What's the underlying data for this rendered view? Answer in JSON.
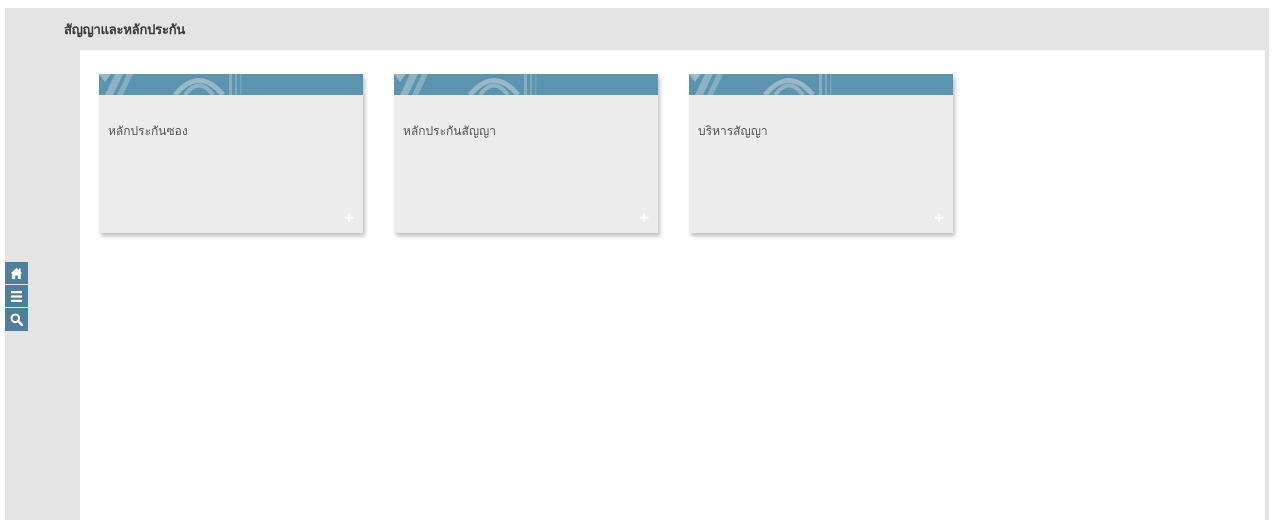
{
  "header": {
    "title": "สัญญาและหลักประกัน"
  },
  "toolbar": {
    "items": [
      {
        "icon": "home-icon"
      },
      {
        "icon": "menu-icon"
      },
      {
        "icon": "search-icon"
      }
    ]
  },
  "tiles": [
    {
      "label": "หลักประกันซอง",
      "action_symbol": "+"
    },
    {
      "label": "หลักประกันสัญญา",
      "action_symbol": "+"
    },
    {
      "label": "บริหารสัญญา",
      "action_symbol": "+"
    }
  ],
  "colors": {
    "accent": "#5c93ae",
    "toolbar": "#4f7f9a",
    "shell": "#e4e4e5",
    "tile": "#ececec"
  }
}
